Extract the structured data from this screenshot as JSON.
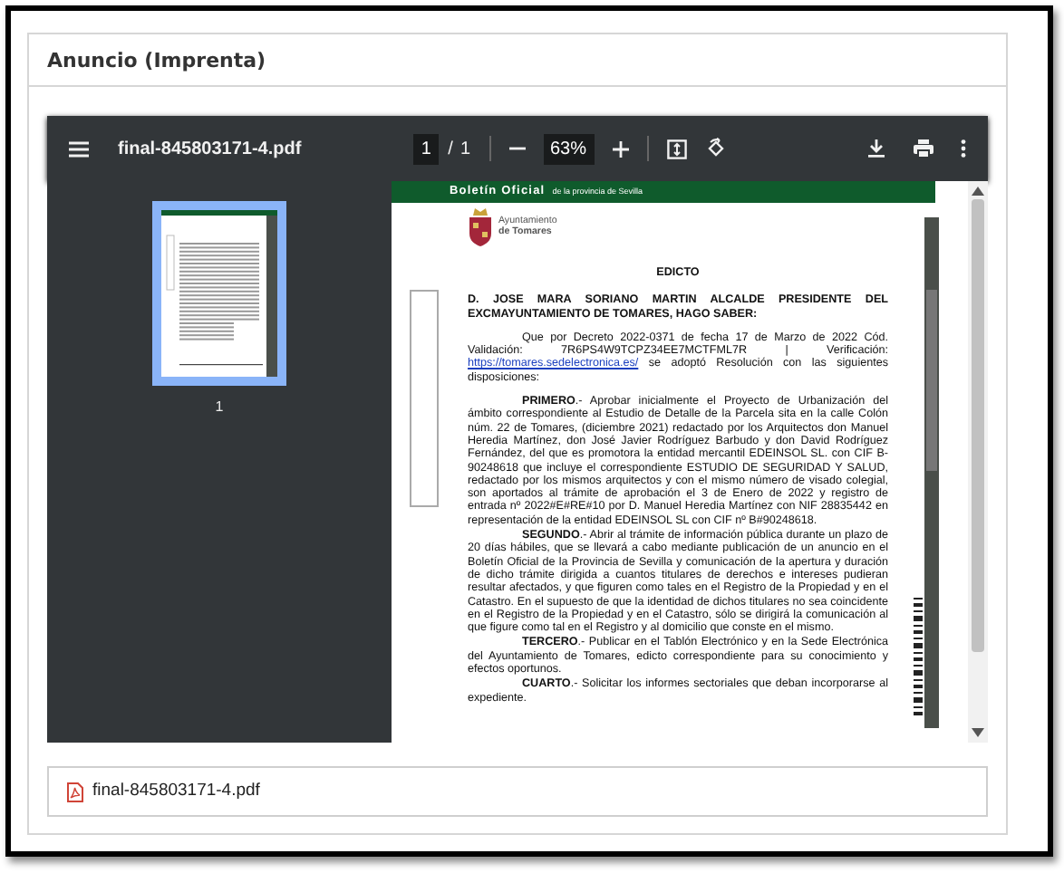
{
  "card": {
    "title": "Anuncio (Imprenta)"
  },
  "viewer": {
    "file_name": "final-845803171-4.pdf",
    "page_input": "1",
    "page_separator": "/",
    "page_total": "1",
    "zoom": "63%",
    "thumbnails": [
      {
        "label": "1",
        "selected": true
      }
    ]
  },
  "document": {
    "banner_title": "Boletín Oficial",
    "banner_subtitle": "de la provincia de Sevilla",
    "council": [
      "Ayuntamiento",
      "de Tomares"
    ],
    "heading": "EDICTO",
    "salutation": "D. JOSE MARA SORIANO MARTIN ALCALDE PRESIDENTE DEL EXCMAYUNTAMIENTO DE TOMARES, HAGO SABER:",
    "intro": {
      "before": "Que por Decreto 2022-0371 de fecha 17 de Marzo de 2022 Cód. Validación: 7R6PS4W9TCPZ34EE7MCTFML7R | Verificación:",
      "link": "https://tomares.sedelectronica.es/",
      "after": "se adoptó Resolución con las siguientes disposiciones:"
    },
    "paragraphs": [
      "**PRIMERO**.- Aprobar inicialmente el Proyecto de Urbanización del ámbito correspondiente al Estudio de Detalle de la Parcela sita en la calle Colón núm. 22 de Tomares, (diciembre 2021) redactado por los Arquitectos don Manuel Heredia Martínez, don José Javier Rodríguez Barbudo y don David Rodríguez Fernández, del que es promotora la entidad mercantil EDEINSOL SL. con CIF B-90248618 que incluye el correspondiente ESTUDIO DE SEGURIDAD Y SALUD, redactado por los mismos arquitectos y con el mismo número de visado colegial, son aportados al trámite de aprobación el 3 de Enero de 2022 y registro de entrada nº 2022#E#RE#10 por D. Manuel Heredia Martínez con NIF 28835442 en representación de la entidad EDEINSOL SL con CIF nº B#90248618.",
      "**SEGUNDO**.- Abrir al trámite de información pública durante un plazo de 20 días hábiles, que se llevará a cabo mediante publicación de un anuncio en el Boletín Oficial de la Provincia de Sevilla y comunicación de la apertura y duración de dicho trámite dirigida a cuantos titulares de derechos e intereses pudieran resultar afectados, y que figuren como tales en el Registro de la Propiedad y en el Catastro. En el supuesto de que la identidad de dichos titulares no sea coincidente en el Registro de la Propiedad y en el Catastro, sólo se dirigirá la comunicación al que figure como tal en el Registro y al domicilio que conste en el mismo.",
      "**TERCERO**.- Publicar en el Tablón Electrónico y en la Sede Electrónica del Ayuntamiento de Tomares, edicto correspondiente para su conocimiento y efectos oportunos.",
      "**CUARTO**.- Solicitar los informes sectoriales que deban incorporarse al expediente."
    ]
  },
  "attachment": {
    "file_name": "final-845803171-4.pdf"
  }
}
